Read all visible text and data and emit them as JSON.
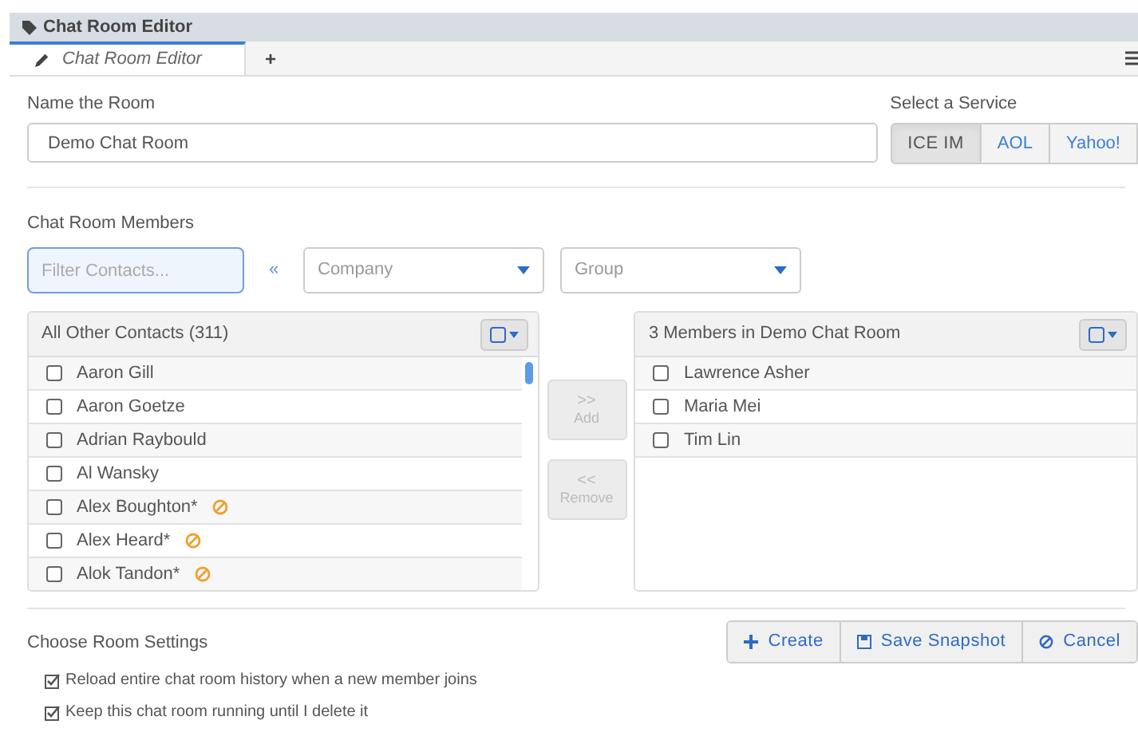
{
  "window": {
    "title": "Chat Room Editor"
  },
  "tabs": [
    {
      "label": "Chat Room Editor",
      "selected": true
    }
  ],
  "tab_add": "+",
  "name_field": {
    "label": "Name the Room",
    "value": "Demo Chat Room"
  },
  "service": {
    "label": "Select a Service",
    "options": [
      {
        "label": "ICE IM",
        "selected": true
      },
      {
        "label": "AOL",
        "selected": false
      },
      {
        "label": "Yahoo!",
        "selected": false
      }
    ]
  },
  "members_section": {
    "title": "Chat Room Members"
  },
  "filter": {
    "placeholder": "Filter Contacts...",
    "separator": "«",
    "company": {
      "placeholder": "Company"
    },
    "group": {
      "placeholder": "Group"
    }
  },
  "contacts": {
    "title": "All Other Contacts (311)",
    "items": [
      {
        "name": "Aaron Gill",
        "checked": false,
        "away": false
      },
      {
        "name": "Aaron Goetze",
        "checked": false,
        "away": false
      },
      {
        "name": "Adrian Raybould",
        "checked": false,
        "away": false
      },
      {
        "name": "Al Wansky",
        "checked": false,
        "away": false
      },
      {
        "name": "Alex Boughton*",
        "checked": false,
        "away": true
      },
      {
        "name": "Alex Heard*",
        "checked": false,
        "away": true
      },
      {
        "name": "Alok Tandon*",
        "checked": false,
        "away": true
      }
    ]
  },
  "transfer": [
    {
      "arrows": ">>",
      "label": "Add"
    },
    {
      "arrows": "<<",
      "label": "Remove"
    }
  ],
  "members": {
    "title": "3 Members in Demo Chat Room",
    "items": [
      {
        "name": "Lawrence Asher",
        "checked": false
      },
      {
        "name": "Maria Mei",
        "checked": false
      },
      {
        "name": "Tim Lin",
        "checked": false
      }
    ]
  },
  "settings": {
    "title": "Choose Room Settings",
    "options": [
      {
        "label": "Reload entire chat room history when a new member joins",
        "checked": true
      },
      {
        "label": "Keep this chat room running until I delete it",
        "checked": true
      }
    ]
  },
  "actions": [
    {
      "kind": "create",
      "label": "Create"
    },
    {
      "kind": "save",
      "label": "Save Snapshot"
    },
    {
      "kind": "cancel",
      "label": "Cancel"
    }
  ]
}
